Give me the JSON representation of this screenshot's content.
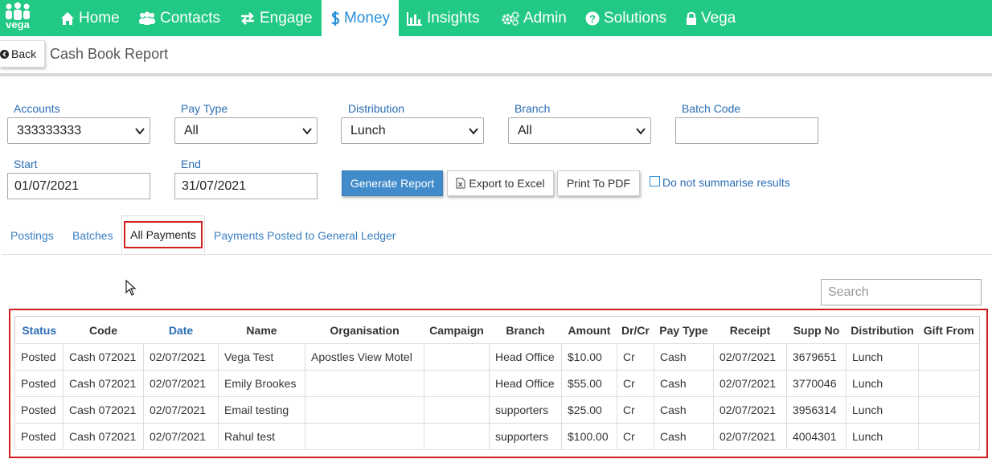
{
  "nav": {
    "logo_text": "vega",
    "items": [
      {
        "label": "Home",
        "icon": "home-icon"
      },
      {
        "label": "Contacts",
        "icon": "users-icon"
      },
      {
        "label": "Engage",
        "icon": "exchange-icon"
      },
      {
        "label": "Money",
        "icon": "dollar-icon",
        "active": true
      },
      {
        "label": "Insights",
        "icon": "bar-chart-icon"
      },
      {
        "label": "Admin",
        "icon": "cogs-icon"
      },
      {
        "label": "Solutions",
        "icon": "question-circle-icon"
      },
      {
        "label": "Vega",
        "icon": "lock-icon"
      }
    ]
  },
  "header": {
    "back_label": "Back",
    "title": "Cash Book Report"
  },
  "filters": {
    "accounts": {
      "label": "Accounts",
      "value": "333333333"
    },
    "pay_type": {
      "label": "Pay Type",
      "value": "All"
    },
    "distribution": {
      "label": "Distribution",
      "value": "Lunch"
    },
    "branch": {
      "label": "Branch",
      "value": "All"
    },
    "batch_code": {
      "label": "Batch Code",
      "value": ""
    },
    "start": {
      "label": "Start",
      "value": "01/07/2021"
    },
    "end": {
      "label": "End",
      "value": "31/07/2021"
    }
  },
  "actions": {
    "generate": "Generate Report",
    "export": "Export to Excel",
    "print": "Print To PDF",
    "summarise": "Do not summarise results"
  },
  "tabs": {
    "postings": "Postings",
    "batches": "Batches",
    "all_payments": "All Payments",
    "posted_gl": "Payments Posted to General Ledger"
  },
  "search": {
    "placeholder": "Search"
  },
  "table": {
    "headers": [
      "Status",
      "Code",
      "Date",
      "Name",
      "Organisation",
      "Campaign",
      "Branch",
      "Amount",
      "Dr/Cr",
      "Pay Type",
      "Receipt",
      "Supp No",
      "Distribution",
      "Gift From"
    ],
    "rows": [
      [
        "Posted",
        "Cash 072021",
        "02/07/2021",
        "Vega Test",
        "Apostles View Motel",
        "",
        "Head Office",
        "$10.00",
        "Cr",
        "Cash",
        "02/07/2021",
        "3679651",
        "Lunch",
        ""
      ],
      [
        "Posted",
        "Cash 072021",
        "02/07/2021",
        "Emily Brookes",
        "",
        "",
        "Head Office",
        "$55.00",
        "Cr",
        "Cash",
        "02/07/2021",
        "3770046",
        "Lunch",
        ""
      ],
      [
        "Posted",
        "Cash 072021",
        "02/07/2021",
        "Email testing",
        "",
        "",
        "supporters",
        "$25.00",
        "Cr",
        "Cash",
        "02/07/2021",
        "3956314",
        "Lunch",
        ""
      ],
      [
        "Posted",
        "Cash 072021",
        "02/07/2021",
        "Rahul test",
        "",
        "",
        "supporters",
        "$100.00",
        "Cr",
        "Cash",
        "02/07/2021",
        "4004301",
        "Lunch",
        ""
      ]
    ]
  },
  "colors": {
    "nav_green": "#22c985",
    "link_blue": "#2a6db5",
    "primary_blue": "#428bca",
    "highlight_red": "#d21e1e"
  }
}
